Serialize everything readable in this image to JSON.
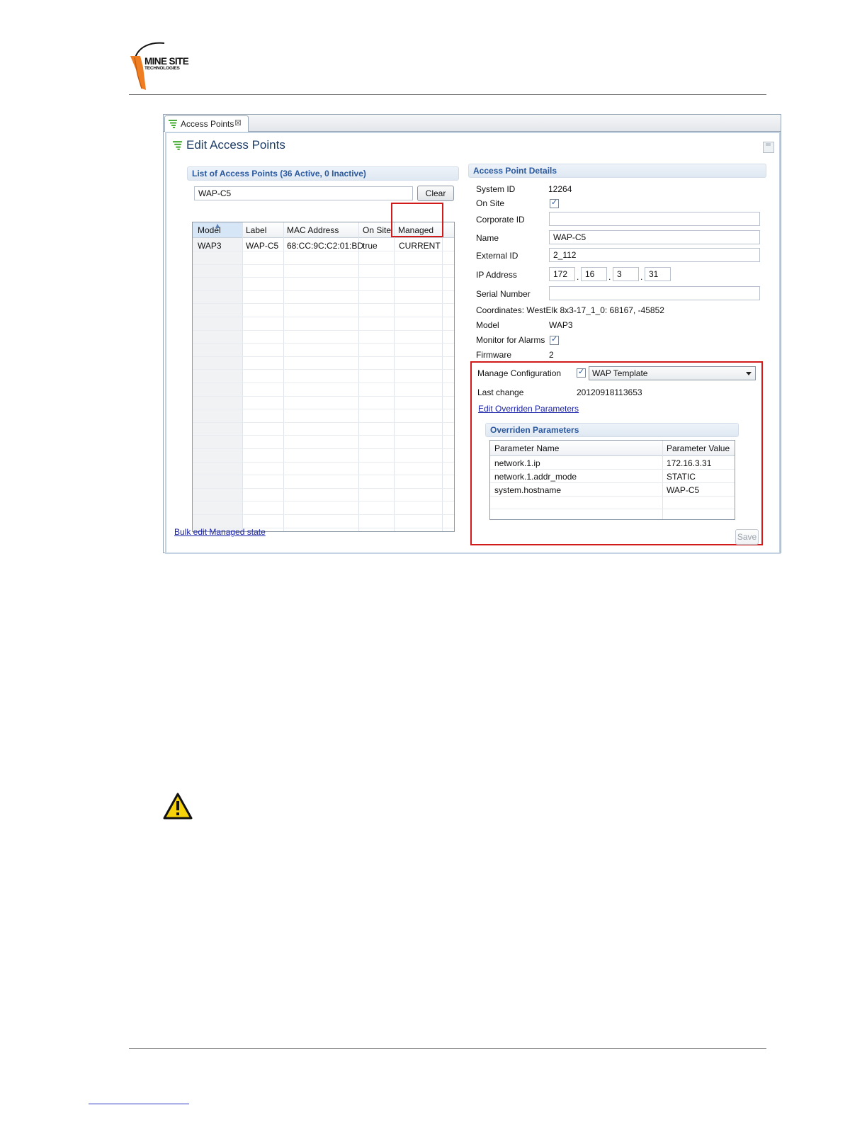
{
  "header": {
    "logo_line1": "MINE SITE",
    "logo_line2": "TECHNOLOGIES"
  },
  "window": {
    "tab_label": "Access Points",
    "tab_close": "⊠",
    "title": "Edit Access Points"
  },
  "list_panel": {
    "section_title": "List of Access Points (36 Active, 0 Inactive)",
    "filter_value": "WAP-C5",
    "clear_label": "Clear",
    "columns": [
      "Model",
      "Label",
      "MAC Address",
      "On Site",
      "Managed"
    ],
    "rows": [
      {
        "model": "WAP3",
        "label": "WAP-C5",
        "mac": "68:CC:9C:C2:01:BD",
        "on_site": "true",
        "managed": "CURRENT"
      }
    ],
    "bulk_link": "Bulk edit Managed state"
  },
  "details": {
    "section_title": "Access Point Details",
    "system_id_label": "System ID",
    "system_id": "12264",
    "on_site_label": "On Site",
    "on_site_checked": true,
    "corporate_id_label": "Corporate ID",
    "corporate_id": "",
    "name_label": "Name",
    "name": "WAP-C5",
    "external_id_label": "External ID",
    "external_id": "2_112",
    "ip_label": "IP Address",
    "ip": [
      "172",
      "16",
      "3",
      "31"
    ],
    "ip_sep": ".",
    "serial_label": "Serial Number",
    "serial": "",
    "coordinates": "Coordinates: WestElk 8x3-17_1_0: 68167, -45852",
    "model_label": "Model",
    "model": "WAP3",
    "monitor_label": "Monitor for Alarms",
    "monitor_checked": true,
    "firmware_label": "Firmware",
    "firmware": "2",
    "manage_config_label": "Manage Configuration",
    "manage_config_checked": true,
    "template": "WAP  Template",
    "last_change_label": "Last change",
    "last_change": "20120918113653",
    "edit_link": "Edit Overriden Parameters",
    "overridden_title": "Overriden Parameters",
    "param_columns": [
      "Parameter Name",
      "Parameter Value"
    ],
    "params": [
      {
        "name": "network.1.ip",
        "value": "172.16.3.31"
      },
      {
        "name": "network.1.addr_mode",
        "value": "STATIC"
      },
      {
        "name": "system.hostname",
        "value": "WAP-C5"
      }
    ],
    "save_label": "Save"
  },
  "colors": {
    "highlight_border": "#d11b1b",
    "section_header_text": "#2a59a0",
    "link": "#1a22a8"
  },
  "icons": [
    "wifi-icon",
    "close-icon",
    "save-icon",
    "checkbox-icon",
    "dropdown-arrow-icon",
    "warning-icon",
    "sort-arrow-icon"
  ]
}
